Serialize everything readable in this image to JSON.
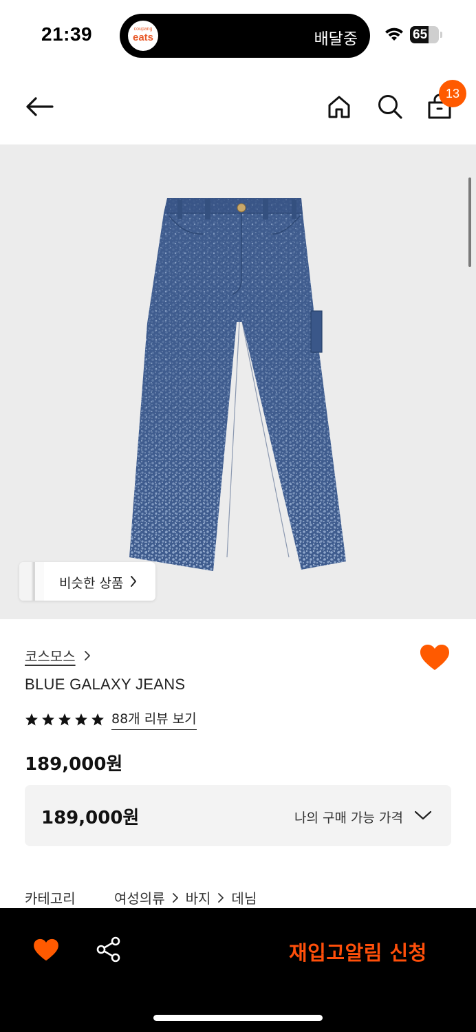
{
  "status_bar": {
    "time": "21:39",
    "island_logo_top": "coupang",
    "island_logo_main": "eats",
    "delivery_status": "배달중",
    "battery_level": "65",
    "battery_fraction": 0.65
  },
  "nav": {
    "cart_count": "13",
    "icons": [
      "back-arrow-icon",
      "home-icon",
      "search-icon",
      "shopping-bag-icon"
    ]
  },
  "product": {
    "similar_items_label": "비슷한 상품",
    "brand": "코스모스",
    "name": "BLUE GALAXY JEANS",
    "rating_stars": 5,
    "review_link": "88개 리뷰 보기",
    "price": "189,000원",
    "my_price": "189,000원",
    "my_price_label": "나의 구매 가능 가격",
    "wishlisted": true
  },
  "category": {
    "label": "카테고리",
    "path": [
      "여성의류",
      "바지",
      "데님"
    ]
  },
  "bottom_bar": {
    "restock_label": "재입고알림 신청"
  },
  "colors": {
    "accent": "#ff5a00",
    "restock_text": "#ff4f0a",
    "denim": "#3d5a8c"
  }
}
